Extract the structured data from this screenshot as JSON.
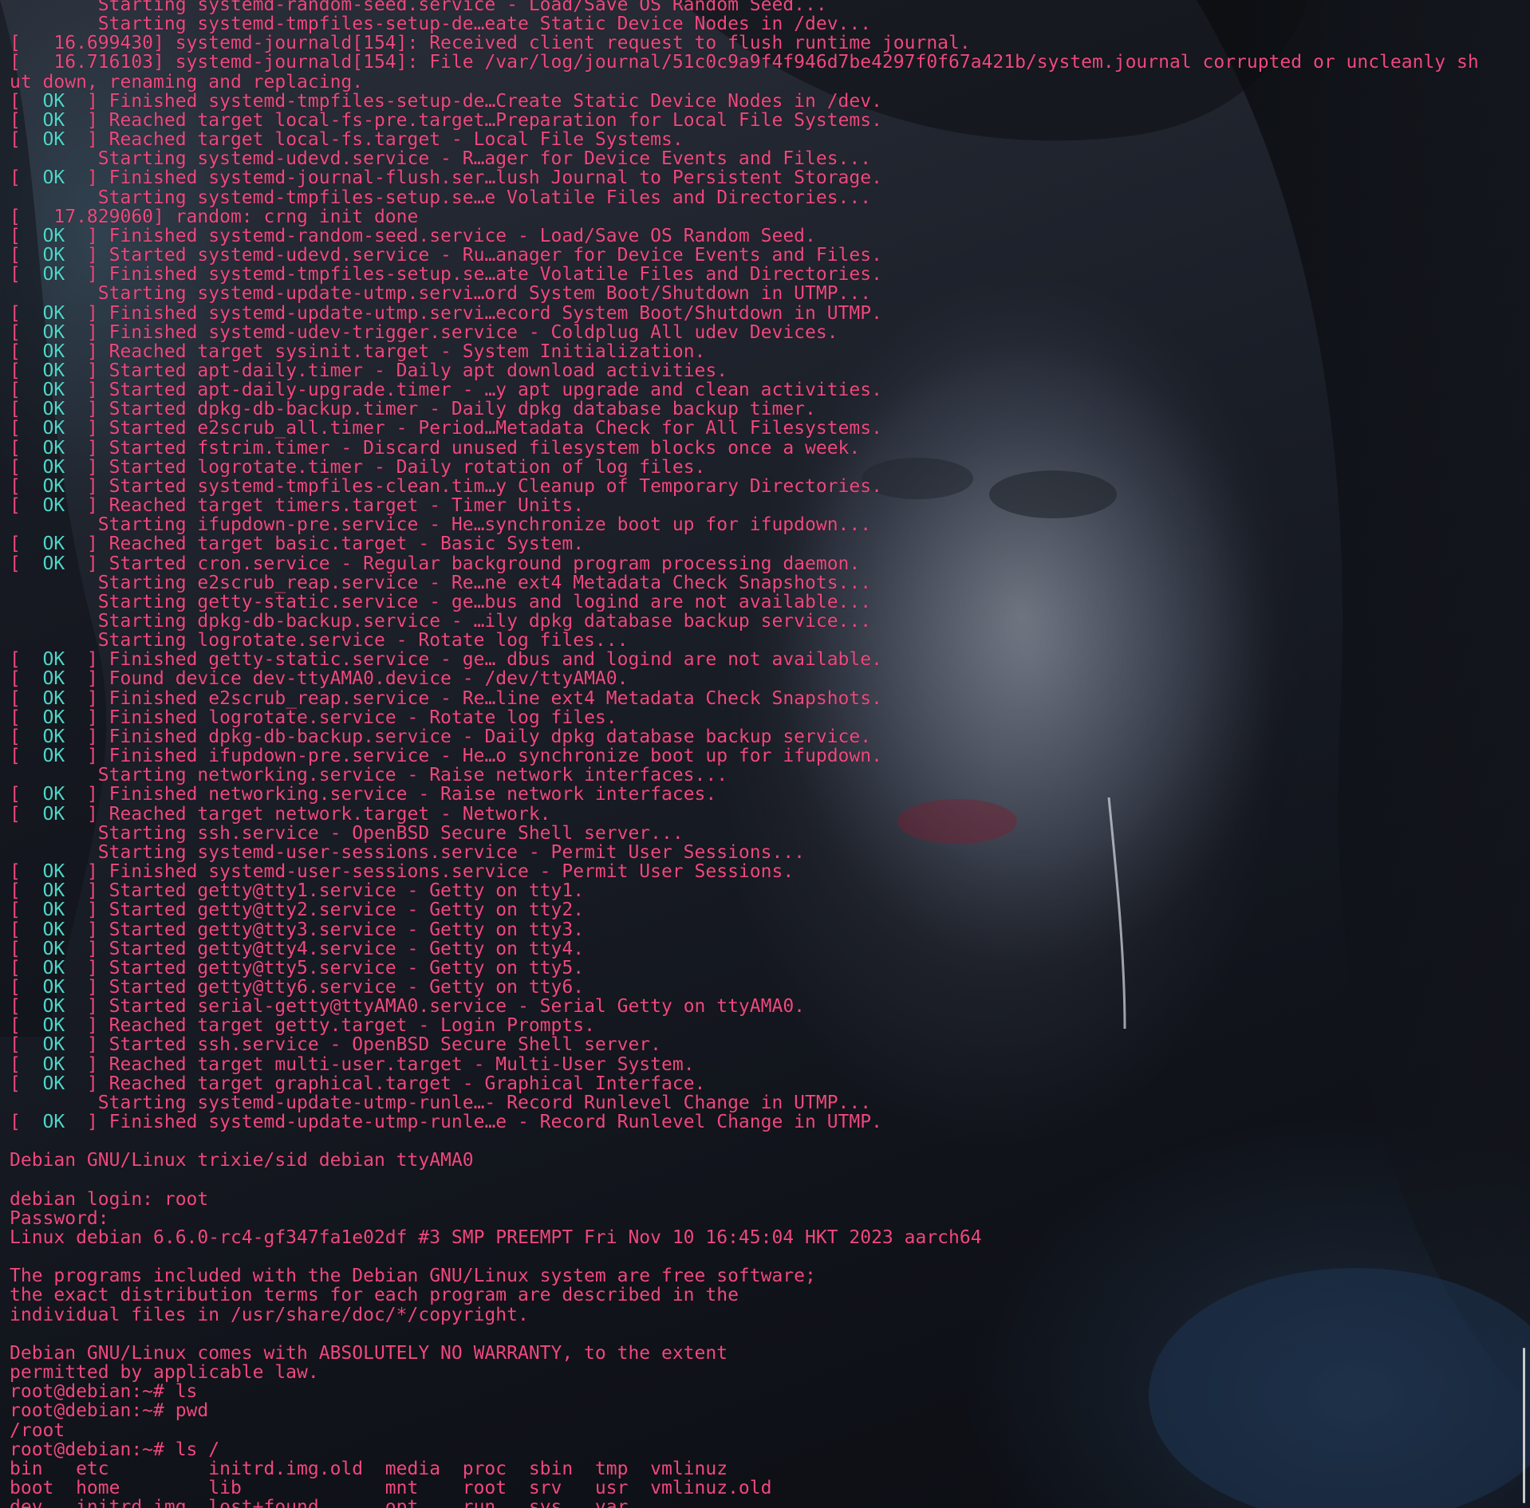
{
  "colors": {
    "text": "#f0487e",
    "ok": "#4fd6c9"
  },
  "terminal": {
    "lines": [
      {
        "pre": "        Starting systemd-random-seed.service - Load/Save OS Random Seed..."
      },
      {
        "pre": "        Starting systemd-tmpfiles-setup-de…eate Static Device Nodes in /dev..."
      },
      {
        "pre": "[   16.699430] systemd-journald[154]: Received client request to flush runtime journal."
      },
      {
        "pre": "[   16.716103] systemd-journald[154]: File /var/log/journal/51c0c9a9f4f946d7be4297f0f67a421b/system.journal corrupted or uncleanly sh"
      },
      {
        "pre": "ut down, renaming and replacing."
      },
      {
        "pre": "[  ",
        "ok": "OK",
        "post": "  ] Finished systemd-tmpfiles-setup-de…Create Static Device Nodes in /dev."
      },
      {
        "pre": "[  ",
        "ok": "OK",
        "post": "  ] Reached target local-fs-pre.target…Preparation for Local File Systems."
      },
      {
        "pre": "[  ",
        "ok": "OK",
        "post": "  ] Reached target local-fs.target - Local File Systems."
      },
      {
        "pre": "        Starting systemd-udevd.service - R…ager for Device Events and Files..."
      },
      {
        "pre": "[  ",
        "ok": "OK",
        "post": "  ] Finished systemd-journal-flush.ser…lush Journal to Persistent Storage."
      },
      {
        "pre": "        Starting systemd-tmpfiles-setup.se…e Volatile Files and Directories..."
      },
      {
        "pre": "[   17.829060] random: crng init done"
      },
      {
        "pre": "[  ",
        "ok": "OK",
        "post": "  ] Finished systemd-random-seed.service - Load/Save OS Random Seed."
      },
      {
        "pre": "[  ",
        "ok": "OK",
        "post": "  ] Started systemd-udevd.service - Ru…anager for Device Events and Files."
      },
      {
        "pre": "[  ",
        "ok": "OK",
        "post": "  ] Finished systemd-tmpfiles-setup.se…ate Volatile Files and Directories."
      },
      {
        "pre": "        Starting systemd-update-utmp.servi…ord System Boot/Shutdown in UTMP..."
      },
      {
        "pre": "[  ",
        "ok": "OK",
        "post": "  ] Finished systemd-update-utmp.servi…ecord System Boot/Shutdown in UTMP."
      },
      {
        "pre": "[  ",
        "ok": "OK",
        "post": "  ] Finished systemd-udev-trigger.service - Coldplug All udev Devices."
      },
      {
        "pre": "[  ",
        "ok": "OK",
        "post": "  ] Reached target sysinit.target - System Initialization."
      },
      {
        "pre": "[  ",
        "ok": "OK",
        "post": "  ] Started apt-daily.timer - Daily apt download activities."
      },
      {
        "pre": "[  ",
        "ok": "OK",
        "post": "  ] Started apt-daily-upgrade.timer - …y apt upgrade and clean activities."
      },
      {
        "pre": "[  ",
        "ok": "OK",
        "post": "  ] Started dpkg-db-backup.timer - Daily dpkg database backup timer."
      },
      {
        "pre": "[  ",
        "ok": "OK",
        "post": "  ] Started e2scrub_all.timer - Period…Metadata Check for All Filesystems."
      },
      {
        "pre": "[  ",
        "ok": "OK",
        "post": "  ] Started fstrim.timer - Discard unused filesystem blocks once a week."
      },
      {
        "pre": "[  ",
        "ok": "OK",
        "post": "  ] Started logrotate.timer - Daily rotation of log files."
      },
      {
        "pre": "[  ",
        "ok": "OK",
        "post": "  ] Started systemd-tmpfiles-clean.tim…y Cleanup of Temporary Directories."
      },
      {
        "pre": "[  ",
        "ok": "OK",
        "post": "  ] Reached target timers.target - Timer Units."
      },
      {
        "pre": "        Starting ifupdown-pre.service - He…synchronize boot up for ifupdown..."
      },
      {
        "pre": "[  ",
        "ok": "OK",
        "post": "  ] Reached target basic.target - Basic System."
      },
      {
        "pre": "[  ",
        "ok": "OK",
        "post": "  ] Started cron.service - Regular background program processing daemon."
      },
      {
        "pre": "        Starting e2scrub_reap.service - Re…ne ext4 Metadata Check Snapshots..."
      },
      {
        "pre": "        Starting getty-static.service - ge…bus and logind are not available..."
      },
      {
        "pre": "        Starting dpkg-db-backup.service - …ily dpkg database backup service..."
      },
      {
        "pre": "        Starting logrotate.service - Rotate log files..."
      },
      {
        "pre": "[  ",
        "ok": "OK",
        "post": "  ] Finished getty-static.service - ge… dbus and logind are not available."
      },
      {
        "pre": "[  ",
        "ok": "OK",
        "post": "  ] Found device dev-ttyAMA0.device - /dev/ttyAMA0."
      },
      {
        "pre": "[  ",
        "ok": "OK",
        "post": "  ] Finished e2scrub_reap.service - Re…line ext4 Metadata Check Snapshots."
      },
      {
        "pre": "[  ",
        "ok": "OK",
        "post": "  ] Finished logrotate.service - Rotate log files."
      },
      {
        "pre": "[  ",
        "ok": "OK",
        "post": "  ] Finished dpkg-db-backup.service - Daily dpkg database backup service."
      },
      {
        "pre": "[  ",
        "ok": "OK",
        "post": "  ] Finished ifupdown-pre.service - He…o synchronize boot up for ifupdown."
      },
      {
        "pre": "        Starting networking.service - Raise network interfaces..."
      },
      {
        "pre": "[  ",
        "ok": "OK",
        "post": "  ] Finished networking.service - Raise network interfaces."
      },
      {
        "pre": "[  ",
        "ok": "OK",
        "post": "  ] Reached target network.target - Network."
      },
      {
        "pre": "        Starting ssh.service - OpenBSD Secure Shell server..."
      },
      {
        "pre": "        Starting systemd-user-sessions.service - Permit User Sessions..."
      },
      {
        "pre": "[  ",
        "ok": "OK",
        "post": "  ] Finished systemd-user-sessions.service - Permit User Sessions."
      },
      {
        "pre": "[  ",
        "ok": "OK",
        "post": "  ] Started getty@tty1.service - Getty on tty1."
      },
      {
        "pre": "[  ",
        "ok": "OK",
        "post": "  ] Started getty@tty2.service - Getty on tty2."
      },
      {
        "pre": "[  ",
        "ok": "OK",
        "post": "  ] Started getty@tty3.service - Getty on tty3."
      },
      {
        "pre": "[  ",
        "ok": "OK",
        "post": "  ] Started getty@tty4.service - Getty on tty4."
      },
      {
        "pre": "[  ",
        "ok": "OK",
        "post": "  ] Started getty@tty5.service - Getty on tty5."
      },
      {
        "pre": "[  ",
        "ok": "OK",
        "post": "  ] Started getty@tty6.service - Getty on tty6."
      },
      {
        "pre": "[  ",
        "ok": "OK",
        "post": "  ] Started serial-getty@ttyAMA0.service - Serial Getty on ttyAMA0."
      },
      {
        "pre": "[  ",
        "ok": "OK",
        "post": "  ] Reached target getty.target - Login Prompts."
      },
      {
        "pre": "[  ",
        "ok": "OK",
        "post": "  ] Started ssh.service - OpenBSD Secure Shell server."
      },
      {
        "pre": "[  ",
        "ok": "OK",
        "post": "  ] Reached target multi-user.target - Multi-User System."
      },
      {
        "pre": "[  ",
        "ok": "OK",
        "post": "  ] Reached target graphical.target - Graphical Interface."
      },
      {
        "pre": "        Starting systemd-update-utmp-runle…- Record Runlevel Change in UTMP..."
      },
      {
        "pre": "[  ",
        "ok": "OK",
        "post": "  ] Finished systemd-update-utmp-runle…e - Record Runlevel Change in UTMP."
      },
      {
        "pre": ""
      },
      {
        "pre": "Debian GNU/Linux trixie/sid debian ttyAMA0"
      },
      {
        "pre": ""
      },
      {
        "pre": "debian login: root"
      },
      {
        "pre": "Password:"
      },
      {
        "pre": "Linux debian 6.6.0-rc4-gf347fa1e02df #3 SMP PREEMPT Fri Nov 10 16:45:04 HKT 2023 aarch64"
      },
      {
        "pre": ""
      },
      {
        "pre": "The programs included with the Debian GNU/Linux system are free software;"
      },
      {
        "pre": "the exact distribution terms for each program are described in the"
      },
      {
        "pre": "individual files in /usr/share/doc/*/copyright."
      },
      {
        "pre": ""
      },
      {
        "pre": "Debian GNU/Linux comes with ABSOLUTELY NO WARRANTY, to the extent"
      },
      {
        "pre": "permitted by applicable law."
      },
      {
        "pre": "root@debian:~# ls"
      },
      {
        "pre": "root@debian:~# pwd"
      },
      {
        "pre": "/root"
      },
      {
        "pre": "root@debian:~# ls /"
      },
      {
        "pre": "bin   etc         initrd.img.old  media  proc  sbin  tmp  vmlinuz"
      },
      {
        "pre": "boot  home        lib             mnt    root  srv   usr  vmlinuz.old"
      },
      {
        "pre": "dev   initrd.img  lost+found      opt    run   sys   var"
      }
    ]
  }
}
